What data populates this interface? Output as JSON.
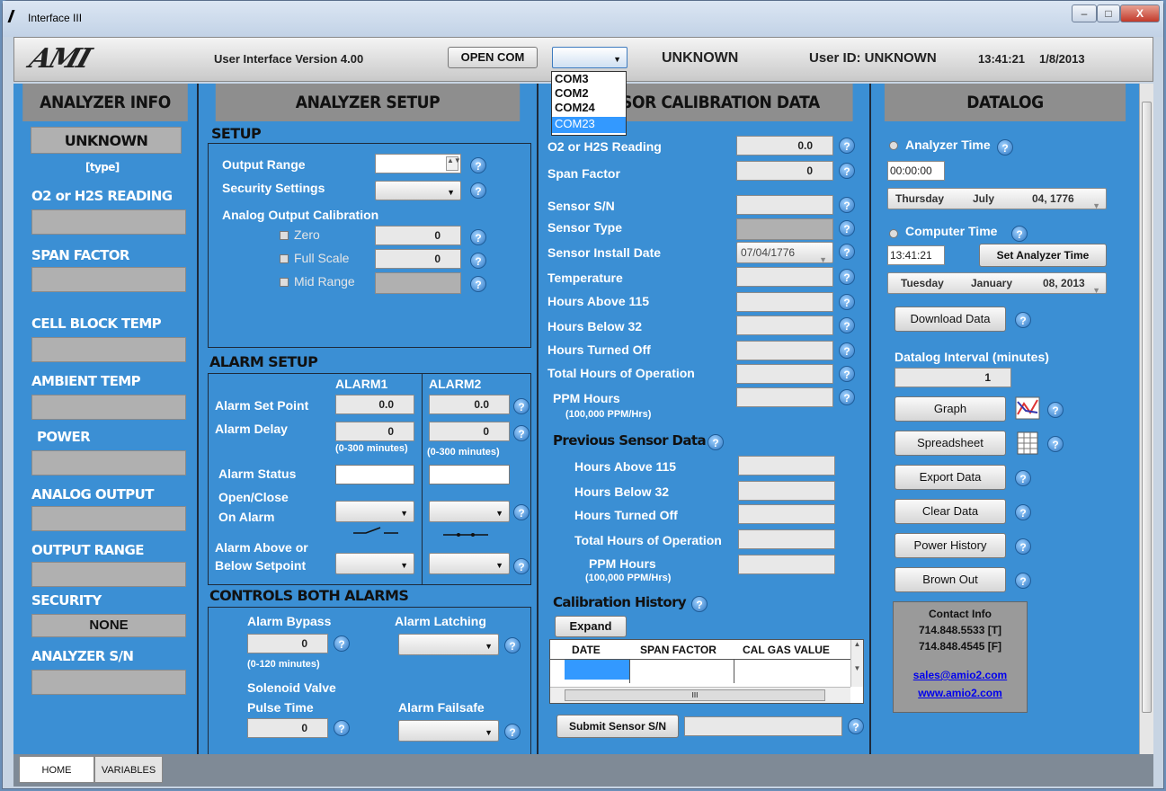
{
  "window": {
    "title": "Interface III",
    "min": "–",
    "max": "□",
    "close": "X"
  },
  "header": {
    "logo": "AMI",
    "version": "User Interface Version 4.00",
    "open_com": "OPEN COM",
    "com_value": "",
    "status": "UNKNOWN",
    "user_id": "User ID: UNKNOWN",
    "time": "13:41:21",
    "date": "1/8/2013"
  },
  "com_dropdown": {
    "options": [
      "COM3",
      "COM2",
      "COM24",
      "COM23"
    ],
    "highlighted": "COM23"
  },
  "analyzer_info": {
    "title": "ANALYZER INFO",
    "model": "UNKNOWN",
    "type": "[type]",
    "o2": "O2 or H2S READING",
    "span": "SPAN FACTOR",
    "cell": "CELL BLOCK TEMP",
    "ambient": "AMBIENT TEMP",
    "power": "POWER",
    "analog": "ANALOG OUTPUT",
    "range": "OUTPUT RANGE",
    "security": "SECURITY",
    "security_value": "NONE",
    "sn": "ANALYZER S/N"
  },
  "analyzer_setup": {
    "title": "ANALYZER SETUP",
    "setup": "SETUP",
    "output_range": "Output Range",
    "security_settings": "Security Settings",
    "analog_cal": "Analog Output Calibration",
    "zero": "Zero",
    "full": "Full Scale",
    "mid": "Mid Range",
    "zero_val": "0",
    "full_val": "0",
    "alarm_setup": "ALARM SETUP",
    "alarm1": "ALARM1",
    "alarm2": "ALARM2",
    "set_point": "Alarm Set Point",
    "sp1": "0.0",
    "sp2": "0.0",
    "delay": "Alarm Delay",
    "d1": "0",
    "d2": "0",
    "delay_range": "(0-300 minutes)",
    "status": "Alarm Status",
    "open_close": "Open/Close",
    "on_alarm": "On Alarm",
    "above": "Alarm Above or",
    "below": "Below Setpoint",
    "controls": "CONTROLS BOTH ALARMS",
    "bypass": "Alarm Bypass",
    "bypass_val": "0",
    "bypass_range": "(0-120 minutes)",
    "latching": "Alarm Latching",
    "solenoid": "Solenoid Valve",
    "pulse": "Pulse Time",
    "pulse_val": "0",
    "failsafe": "Alarm Failsafe"
  },
  "sensor": {
    "title": "SENSOR CALIBRATION DATA",
    "reading": "O2 or H2S Reading",
    "reading_val": "0.0",
    "span": "Span Factor",
    "span_val": "0",
    "sn": "Sensor S/N",
    "type": "Sensor Type",
    "install": "Sensor Install Date",
    "install_val": "07/04/1776",
    "temp": "Temperature",
    "above": "Hours Above 115",
    "below": "Hours Below 32",
    "off": "Hours Turned Off",
    "total": "Total Hours of Operation",
    "ppm": "PPM Hours",
    "ppm_sub": "(100,000 PPM/Hrs)",
    "prev": "Previous Sensor Data",
    "p_above": "Hours Above 115",
    "p_below": "Hours Below 32",
    "p_off": "Hours Turned Off",
    "p_total": "Total Hours of Operation",
    "p_ppm": "PPM Hours",
    "p_ppm_sub": "(100,000 PPM/Hrs)",
    "history": "Calibration History",
    "expand": "Expand",
    "columns": [
      "DATE",
      "SPAN FACTOR",
      "CAL GAS VALUE"
    ],
    "submit": "Submit Sensor S/N",
    "scroll_mark": "III"
  },
  "datalog": {
    "title": "DATALOG",
    "analyzer_time": "Analyzer Time",
    "a_time": "00:00:00",
    "a_day": "Thursday",
    "a_month": "July",
    "a_date": "04, 1776",
    "computer_time": "Computer Time",
    "c_time": "13:41:21",
    "set": "Set Analyzer Time",
    "c_day": "Tuesday",
    "c_month": "January",
    "c_date": "08, 2013",
    "download": "Download Data",
    "interval": "Datalog Interval (minutes)",
    "interval_val": "1",
    "graph": "Graph",
    "spreadsheet": "Spreadsheet",
    "export": "Export Data",
    "clear": "Clear Data",
    "power": "Power History",
    "brown": "Brown Out",
    "contact": "Contact Info",
    "phone": "714.848.5533 [T]",
    "fax": "714.848.4545 [F]",
    "email": "sales@amio2.com",
    "web": "www.amio2.com"
  },
  "tabs": [
    "HOME",
    "VARIABLES"
  ],
  "help_glyph": "?"
}
